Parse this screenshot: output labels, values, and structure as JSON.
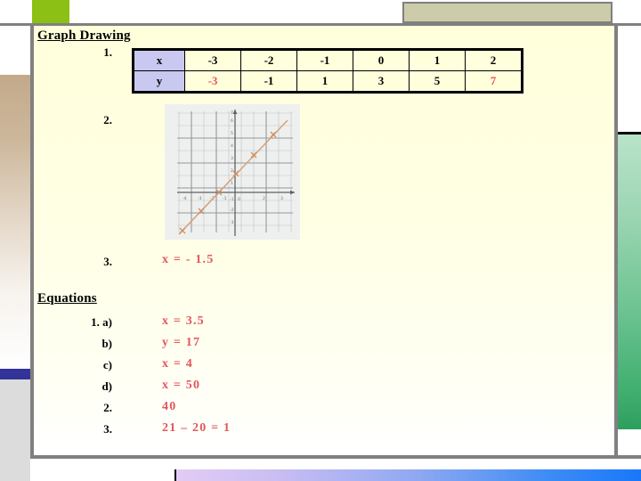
{
  "slide": {
    "sections": {
      "graph_drawing_title": "Graph Drawing",
      "equations_title": "Equations"
    },
    "graph_drawing": {
      "item1_number": "1.",
      "item2_number": "2.",
      "item3_number": "3.",
      "item3_answer": "x  =  - 1.5",
      "table": {
        "row_headers": [
          "x",
          "y"
        ],
        "x_values": [
          "-3",
          "-2",
          "-1",
          "0",
          "1",
          "2"
        ],
        "y_values": [
          "-3",
          "-1",
          "1",
          "3",
          "5",
          "7"
        ],
        "highlighted_cells": [
          "y:-3",
          "y:7"
        ]
      },
      "figure_caption": "hand-drawn coordinate grid with plotted straight line"
    },
    "equations": {
      "items": [
        {
          "number": "1. a)",
          "answer": "x  =  3.5"
        },
        {
          "number": "b)",
          "answer": "y  =  17"
        },
        {
          "number": "c)",
          "answer": "x  =  4"
        },
        {
          "number": "d)",
          "answer": "x  =  50"
        },
        {
          "number": "2.",
          "answer": "40"
        },
        {
          "number": "3.",
          "answer": "21 – 20  =  1"
        }
      ]
    }
  },
  "theme": {
    "answer_color": "#E2565B",
    "content_background": "#FFFFDC",
    "table_header_fill": "#C8C8F0",
    "accent_green": "#8CC014",
    "accent_light_green": "#CADF7B",
    "accent_khaki": "#CCCBAA",
    "accent_blue": "#333399",
    "rule_gray": "#808080"
  }
}
